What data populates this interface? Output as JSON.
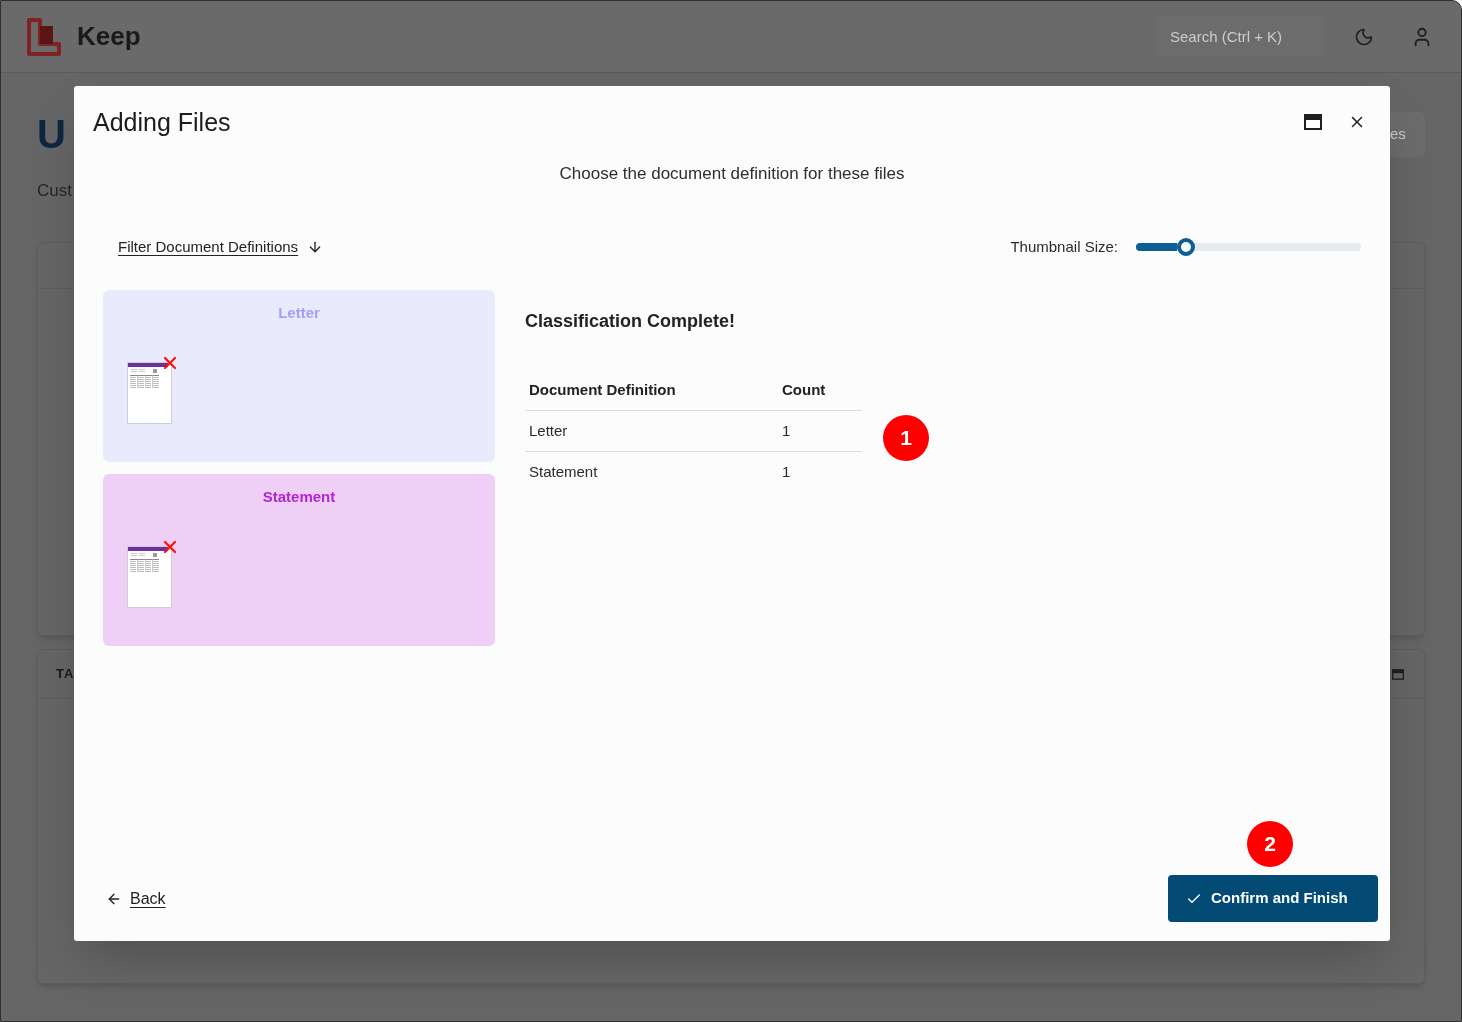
{
  "app": {
    "name": "Keep",
    "search": {
      "placeholder": "Search (Ctrl + K)"
    }
  },
  "page": {
    "title": "U",
    "subtitle": "Cust",
    "action_button": "es",
    "panel_heading": "TA"
  },
  "dialog": {
    "title": "Adding Files",
    "subtitle": "Choose the document definition for these files",
    "filter_link": "Filter Document Definitions",
    "thumbnail_size": {
      "label": "Thumbnail Size:",
      "level": 0.22
    },
    "cards": [
      {
        "title": "Letter",
        "color": "#a0a0f8",
        "files": [
          {
            "removable": true
          }
        ]
      },
      {
        "title": "Statement",
        "color": "#b424d2",
        "files": [
          {
            "removable": true
          }
        ]
      }
    ],
    "summary": {
      "heading": "Classification Complete!",
      "columns": [
        "Document Definition",
        "Count"
      ],
      "rows": [
        [
          "Letter",
          "1"
        ],
        [
          "Statement",
          "1"
        ]
      ]
    },
    "back_link": "Back",
    "confirm_button": "Confirm and Finish"
  },
  "callouts": [
    "1",
    "2"
  ]
}
